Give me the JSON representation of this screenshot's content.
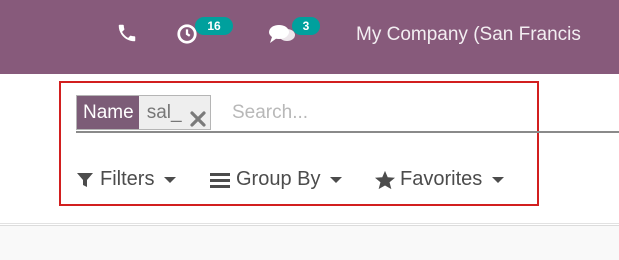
{
  "topbar": {
    "phone_icon": "phone-icon",
    "activity_icon": "clock-icon",
    "activity_count": "16",
    "messages_icon": "chat-icon",
    "messages_count": "3",
    "company": "My Company (San Francis",
    "color": "#875a7b",
    "badge_color": "#00a09d"
  },
  "search": {
    "facet_label": "Name",
    "facet_value": "sal_",
    "placeholder": "Search..."
  },
  "dropdowns": {
    "filters": "Filters",
    "group_by": "Group By",
    "favorites": "Favorites"
  }
}
